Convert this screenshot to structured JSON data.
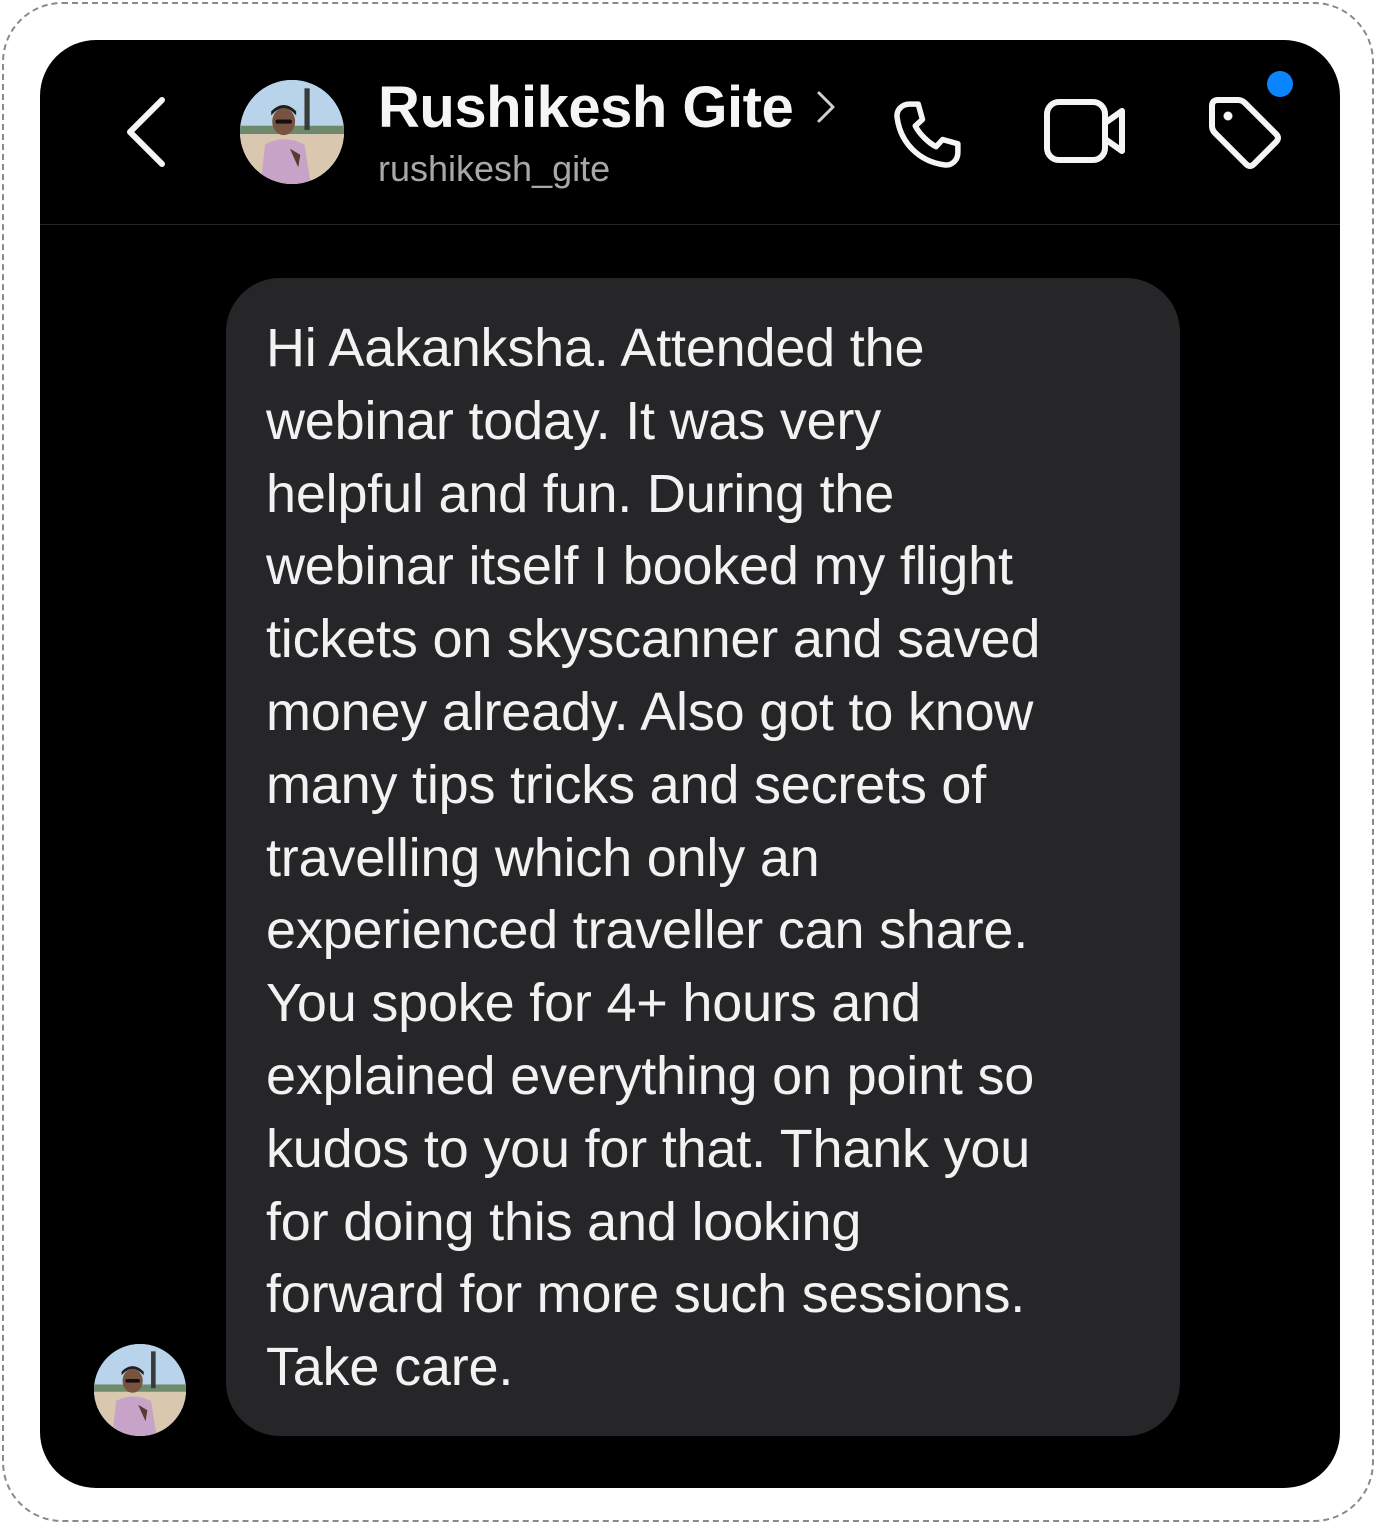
{
  "header": {
    "contact_name": "Rushikesh Gite",
    "username": "rushikesh_gite",
    "icons": {
      "back": "chevron-left-icon",
      "profile_chevron": "chevron-right-icon",
      "call": "phone-icon",
      "video": "video-camera-icon",
      "tag": "tag-icon"
    },
    "notification_dot_color": "#0a84ff"
  },
  "message": {
    "text": "Hi Aakanksha. Attended the\nwebinar today. It was very\nhelpful and fun. During the\nwebinar itself I booked my flight\ntickets on skyscanner and saved\nmoney already. Also got to know\nmany tips tricks and secrets of\ntravelling which only an\nexperienced traveller can share.\nYou spoke for 4+ hours and\nexplained everything on point so\nkudos to you for that. Thank you\nfor doing this and looking\nforward for more such sessions.\nTake care.",
    "bubble_color": "#262628"
  },
  "colors": {
    "background": "#000000",
    "text_primary": "#f5f5f5",
    "text_secondary": "#a8a8a8"
  }
}
